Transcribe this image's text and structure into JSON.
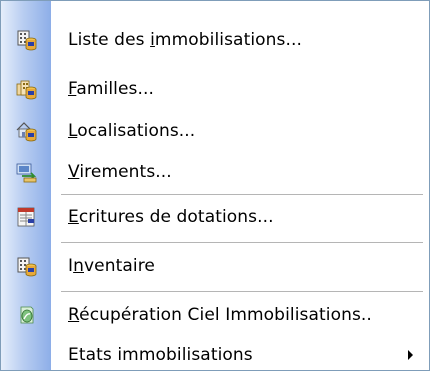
{
  "menu": {
    "items": [
      {
        "name": "menu-item-liste-immobilisations",
        "icon": "building-database-icon",
        "pre": "Liste des ",
        "mnemonic": "i",
        "post": "mmobilisations...",
        "separator_after": false,
        "submenu": false
      },
      {
        "name": "menu-item-familles",
        "icon": "family-buildings-database-icon",
        "pre": "",
        "mnemonic": "F",
        "post": "amilles...",
        "separator_after": false,
        "submenu": false
      },
      {
        "name": "menu-item-localisations",
        "icon": "house-database-icon",
        "pre": "",
        "mnemonic": "L",
        "post": "ocalisations...",
        "separator_after": false,
        "submenu": false
      },
      {
        "name": "menu-item-virements",
        "icon": "transfer-icon",
        "pre": "",
        "mnemonic": "V",
        "post": "irements...",
        "separator_after": true,
        "submenu": false
      },
      {
        "name": "menu-item-ecritures-dotations",
        "icon": "accounting-entries-icon",
        "pre": "",
        "mnemonic": "E",
        "post": "critures de dotations...",
        "separator_after": true,
        "submenu": false
      },
      {
        "name": "menu-item-inventaire",
        "icon": "inventory-database-icon",
        "pre": "I",
        "mnemonic": "n",
        "post": "ventaire",
        "separator_after": true,
        "submenu": false
      },
      {
        "name": "menu-item-recuperation-ciel",
        "icon": "ciel-recovery-icon",
        "pre": "",
        "mnemonic": "R",
        "post": "écupération Ciel Immobilisations..",
        "separator_after": false,
        "submenu": false
      },
      {
        "name": "menu-item-etats-immobilisations",
        "icon": "",
        "pre": "Etats immobilisations",
        "mnemonic": "",
        "post": "",
        "separator_after": false,
        "submenu": true
      }
    ]
  },
  "colors": {
    "gutter_light": "#e5eefb",
    "gutter_dark": "#8daee8",
    "border": "#7f9db9"
  }
}
